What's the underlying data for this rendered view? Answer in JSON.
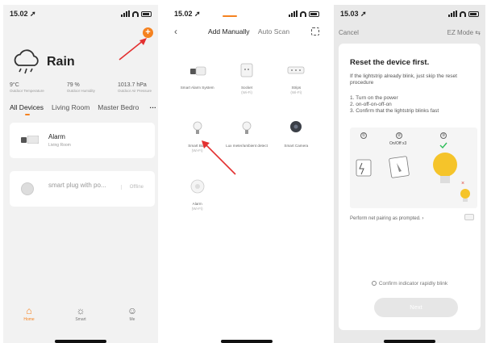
{
  "colors": {
    "accent": "#f58220",
    "arrow": "#e33030",
    "bulb": "#f5c42a",
    "check": "#2ebd59",
    "x_mark": "#e0493e"
  },
  "panel1": {
    "status_time": "15.02 ➚",
    "add_label": "+",
    "weather": {
      "title": "Rain",
      "icon": "cloud-rain-icon",
      "stats": [
        {
          "value": "9°C",
          "label": "Outdoor Temperature"
        },
        {
          "value": "79 %",
          "label": "Outdoor Humidity"
        },
        {
          "value": "1013.7 hPa",
          "label": "Outdoor Air Pressure"
        }
      ]
    },
    "rooms": {
      "all": "All Devices",
      "living": "Living Room",
      "master": "Master Bedro",
      "more": "···"
    },
    "devices": [
      {
        "name": "Alarm",
        "room": "Living Room"
      },
      {
        "name": "smart plug with po...",
        "status": "Offline"
      }
    ],
    "tabs": {
      "home": "Home",
      "smart": "Smart",
      "me": "Me"
    }
  },
  "panel2": {
    "status_time": "15.02 ➚",
    "back": "‹",
    "tab_manual": "Add Manually",
    "tab_scan": "Auto Scan",
    "items": [
      {
        "label": "Smart Alarm System",
        "sub": ""
      },
      {
        "label": "Socket",
        "sub": "(Wi-Fi)"
      },
      {
        "label": "Strips",
        "sub": "(Wi-Fi)"
      },
      {
        "label": "Smart Bulb",
        "sub": "(Wi-Fi)"
      },
      {
        "label": "Lux meter/ambient detect",
        "sub": ""
      },
      {
        "label": "Smart Camera",
        "sub": ""
      },
      {
        "label": "Alarm",
        "sub": "(Wi-Fi)"
      }
    ]
  },
  "panel3": {
    "status_time": "15.03 ➚",
    "cancel": "Cancel",
    "mode": "EZ Mode ⇆",
    "title": "Reset the device first.",
    "subtitle": "If the lightstrip already blink, just skip the reset procedure",
    "steps": [
      "1. Turn on the power",
      "2. on-off-on-off-on",
      "3. Confirm that the lightstrip blinks fast"
    ],
    "step_numbers": [
      "①",
      "②",
      "③"
    ],
    "onoff_label": "On/Off x3",
    "prompt": "Perform net pairing as prompted. ›",
    "confirm": "Confirm indicator rapidly blink",
    "next": "Next"
  }
}
